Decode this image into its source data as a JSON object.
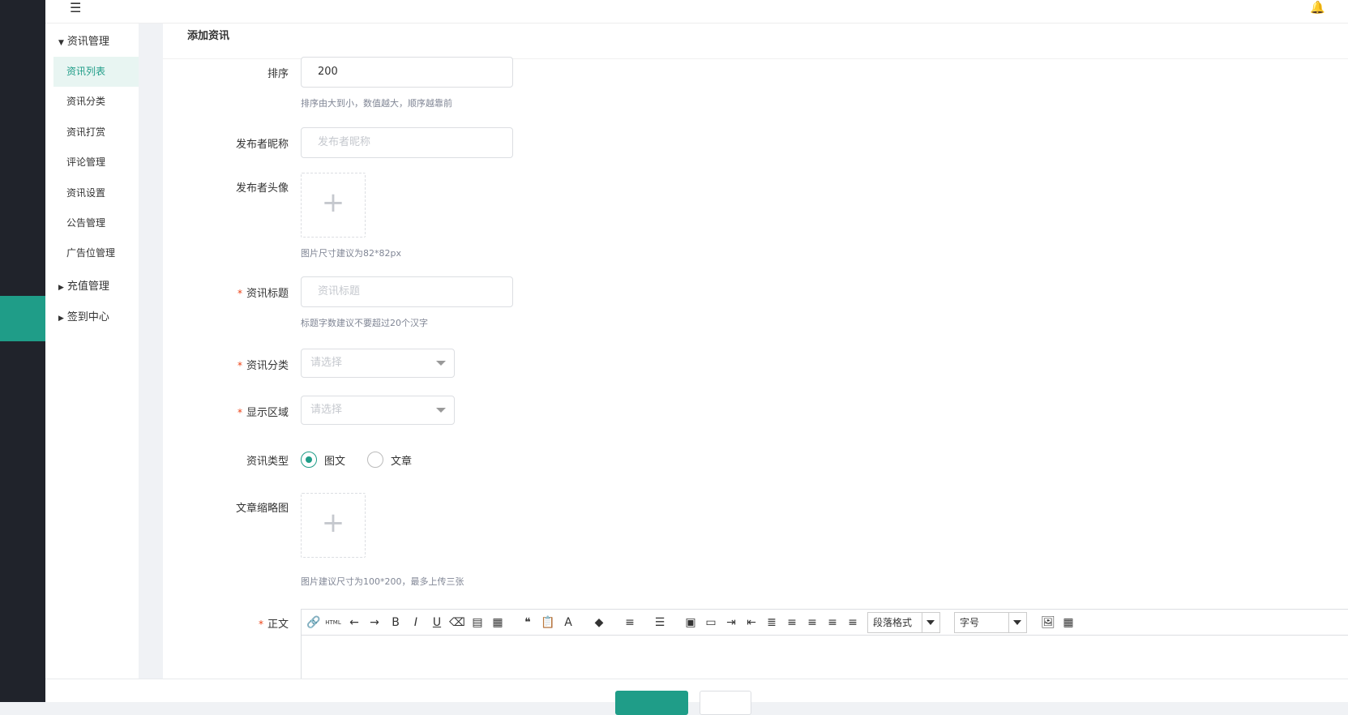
{
  "sidebar": {
    "groups": [
      {
        "label": "资讯管理",
        "expanded": true
      },
      {
        "label": "充值管理",
        "expanded": false
      },
      {
        "label": "签到中心",
        "expanded": false
      }
    ],
    "items": [
      "资讯列表",
      "资讯分类",
      "资讯打赏",
      "评论管理",
      "资讯设置",
      "公告管理",
      "广告位管理"
    ]
  },
  "page": {
    "title": "添加资讯"
  },
  "form": {
    "sort": {
      "label": "排序",
      "value": "200",
      "hint": "排序由大到小，数值越大，顺序越靠前"
    },
    "nickname": {
      "label": "发布者昵称",
      "placeholder": "发布者昵称"
    },
    "avatar": {
      "label": "发布者头像",
      "hint": "图片尺寸建议为82*82px"
    },
    "title": {
      "label": "资讯标题",
      "placeholder": "资讯标题",
      "hint": "标题字数建议不要超过20个汉字"
    },
    "category": {
      "label": "资讯分类",
      "placeholder": "请选择"
    },
    "area": {
      "label": "显示区域",
      "placeholder": "请选择"
    },
    "type": {
      "label": "资讯类型",
      "options": [
        "图文",
        "文章"
      ],
      "selected": "图文"
    },
    "thumbnail": {
      "label": "文章缩略图",
      "hint": "图片建议尺寸为100*200，最多上传三张"
    },
    "body": {
      "label": "正文",
      "paragraph_format": "段落格式",
      "font_size": "字号"
    }
  },
  "colors": {
    "accent": "#1f9d88",
    "rail": "#20232b",
    "required": "#ed4014"
  }
}
